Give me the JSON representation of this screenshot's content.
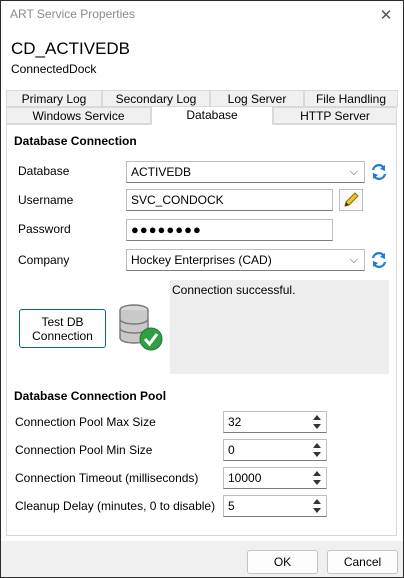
{
  "window": {
    "title": "ART Service Properties"
  },
  "service": {
    "name": "CD_ACTIVEDB",
    "subtitle": "ConnectedDock"
  },
  "tabs": {
    "row1": [
      "Primary Log",
      "Secondary Log",
      "Log Server",
      "File Handling"
    ],
    "row2": [
      "Windows Service",
      "Database",
      "HTTP Server"
    ],
    "active": "Database"
  },
  "db_connection": {
    "title": "Database Connection",
    "database_label": "Database",
    "database_value": "ACTIVEDB",
    "username_label": "Username",
    "username_value": "SVC_CONDOCK",
    "password_label": "Password",
    "password_value": "●●●●●●●●",
    "company_label": "Company",
    "company_value": "Hockey Enterprises (CAD)",
    "test_button": "Test DB Connection",
    "test_button_line1": "Test DB",
    "test_button_line2": "Connection",
    "status": "Connection successful."
  },
  "pool": {
    "title": "Database Connection Pool",
    "max_label": "Connection Pool Max Size",
    "max_value": "32",
    "min_label": "Connection Pool Min Size",
    "min_value": "0",
    "timeout_label": "Connection Timeout (milliseconds)",
    "timeout_value": "10000",
    "cleanup_label": "Cleanup Delay (minutes, 0 to disable)",
    "cleanup_value": "5"
  },
  "footer": {
    "ok": "OK",
    "cancel": "Cancel"
  },
  "colors": {
    "accent": "#0e5fbd",
    "success": "#2ea043"
  }
}
